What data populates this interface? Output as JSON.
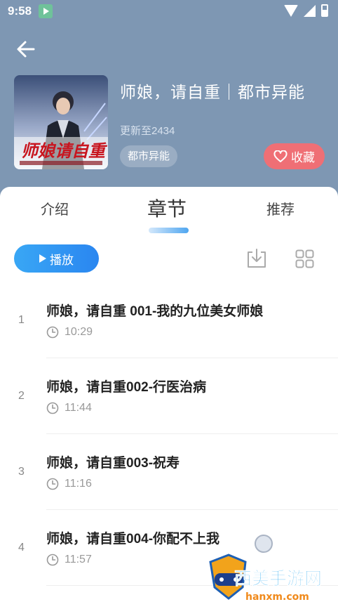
{
  "status_bar": {
    "time": "9:58"
  },
  "book": {
    "title": "师娘，请自重｜都市异能",
    "update": "更新至2434",
    "genre": "都市异能",
    "favorite_label": "收藏",
    "cover_title": "师娘请自重"
  },
  "tabs": [
    {
      "label": "介绍"
    },
    {
      "label": "章节"
    },
    {
      "label": "推荐"
    }
  ],
  "toolbar": {
    "play_label": "播放"
  },
  "chapters": [
    {
      "num": "1",
      "title": "师娘，请自重 001-我的九位美女师娘",
      "duration": "10:29"
    },
    {
      "num": "2",
      "title": "师娘，请自重002-行医治病",
      "duration": "11:44"
    },
    {
      "num": "3",
      "title": "师娘，请自重003-祝寿",
      "duration": "11:16"
    },
    {
      "num": "4",
      "title": "师娘，请自重004-你配不上我",
      "duration": "11:57"
    }
  ],
  "watermark": {
    "text": "西美手游网",
    "url": "hanxm.com"
  },
  "colors": {
    "header_bg": "#7e97b3",
    "accent_blue": "#2a86f0",
    "favorite_red": "#ef6f75"
  }
}
